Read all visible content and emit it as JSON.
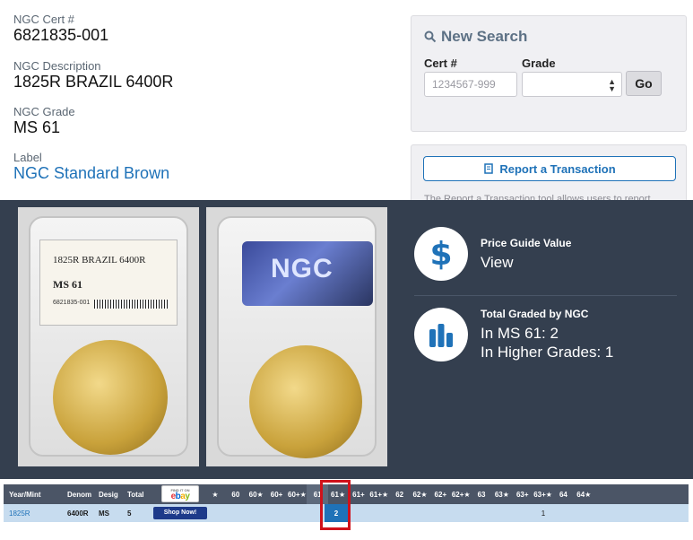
{
  "cert_info": {
    "cert": {
      "label": "NGC Cert #",
      "value": "6821835-001"
    },
    "description": {
      "label": "NGC Description",
      "value": "1825R BRAZIL 6400R"
    },
    "grade": {
      "label": "NGC Grade",
      "value": "MS 61"
    },
    "label": {
      "label": "Label",
      "value": "NGC Standard Brown"
    }
  },
  "search": {
    "title": "New Search",
    "cert_label": "Cert #",
    "cert_placeholder": "1234567-999",
    "grade_label": "Grade",
    "grade_value": "",
    "go_label": "Go"
  },
  "report": {
    "button_label": "Report a Transaction",
    "hint": "The Report a Transaction tool allows users to report"
  },
  "slab": {
    "label_line1": "1825R BRAZIL 6400R",
    "label_grade": "MS 61",
    "label_cert": "6821835-001",
    "holo_text": "NGC"
  },
  "price_guide": {
    "title": "Price Guide Value",
    "value": "View"
  },
  "total_graded": {
    "title": "Total Graded by NGC",
    "line1": "In MS 61: 2",
    "line2": "In Higher Grades: 1"
  },
  "census": {
    "headers": {
      "year": "Year/Mint",
      "denom": "Denom",
      "desig": "Desig",
      "total": "Total",
      "ebay_small": "FIND IT ON",
      "ebay_logo": "ebay"
    },
    "grade_headers": [
      "★",
      "60",
      "60★",
      "60+",
      "60+★",
      "61",
      "61★",
      "61+",
      "61+★",
      "62",
      "62★",
      "62+",
      "62+★",
      "63",
      "63★",
      "63+",
      "63+★",
      "64",
      "64★"
    ],
    "row": {
      "year": "1825R",
      "denom": "6400R",
      "desig": "MS",
      "total": "5",
      "shop_label": "Shop Now!",
      "ms61": "2",
      "ms63": "1"
    }
  },
  "colors": {
    "brand_blue": "#1f72b8",
    "band_dark": "#343f4f",
    "highlight_red": "#d0121b"
  }
}
